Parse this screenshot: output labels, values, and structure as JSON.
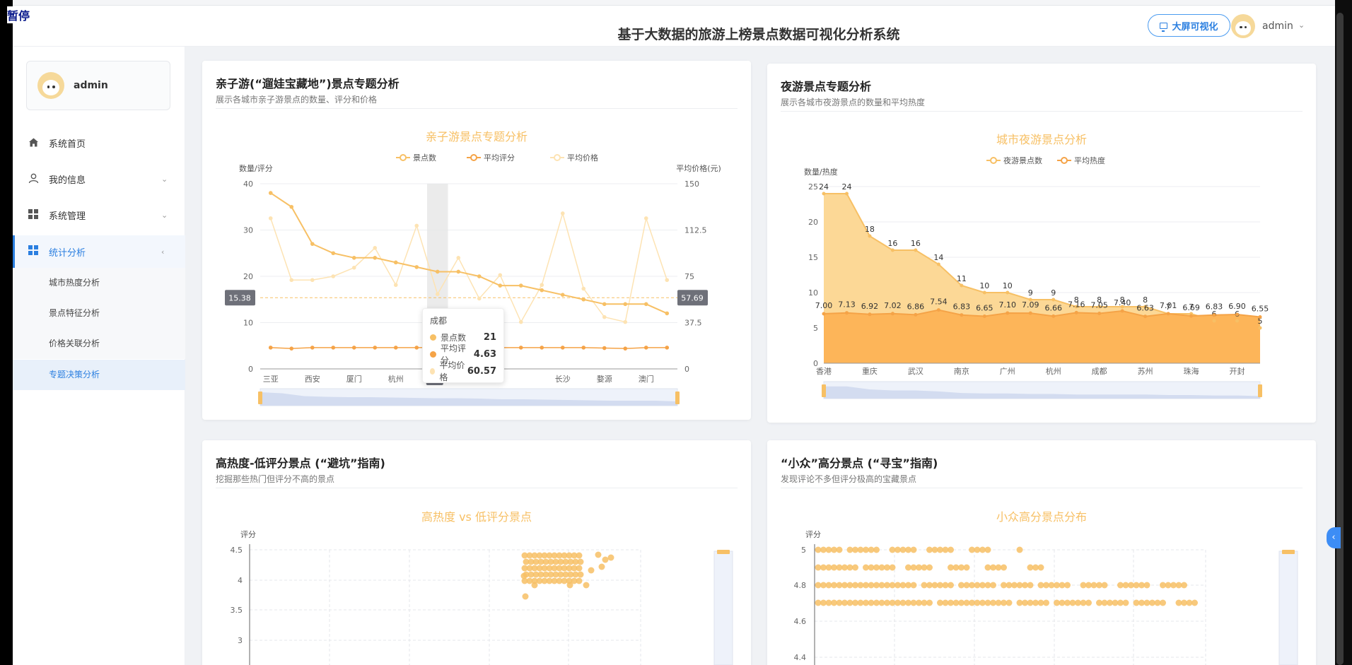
{
  "app": {
    "pause_label": "暂停",
    "title": "基于大数据的旅游上榜景点数据可视化分析系统",
    "bigscreen_label": "大屏可视化",
    "user_name": "admin"
  },
  "sidebar": {
    "user_name": "admin",
    "items": [
      {
        "label": "系统首页",
        "icon": "home-icon"
      },
      {
        "label": "我的信息",
        "icon": "user-icon"
      },
      {
        "label": "系统管理",
        "icon": "grid-icon"
      },
      {
        "label": "统计分析",
        "icon": "grid-icon"
      }
    ],
    "sub_items": [
      "城市热度分析",
      "景点特征分析",
      "价格关联分析",
      "专题决策分析"
    ]
  },
  "cards": {
    "family": {
      "title": "亲子游(“遛娃宝藏地”)景点专题分析",
      "subtitle": "展示各城市亲子游景点的数量、评分和价格"
    },
    "night": {
      "title": "夜游景点专题分析",
      "subtitle": "展示各城市夜游景点的数量和平均热度"
    },
    "avoid": {
      "title": "高热度-低评分景点 (“避坑”指南)",
      "subtitle": "挖掘那些热门但评分不高的景点"
    },
    "niche": {
      "title": "“小众”高分景点 (“寻宝”指南)",
      "subtitle": "发现评论不多但评分极高的宝藏景点"
    }
  },
  "tooltip": {
    "city": "成都",
    "rows": [
      {
        "label": "景点数",
        "value": "21",
        "color": "#f7c065"
      },
      {
        "label": "平均评分",
        "value": "4.63",
        "color": "#f5a347"
      },
      {
        "label": "平均价格",
        "value": "60.57",
        "color": "#fde3b3"
      }
    ]
  },
  "chart_data": [
    {
      "type": "line",
      "title": "亲子游景点专题分析",
      "legend": [
        "景点数",
        "平均评分",
        "平均价格"
      ],
      "ylabel": "数量/评分",
      "ylabel_right": "平均价格(元)",
      "ylim": [
        0,
        40
      ],
      "ylim_right": [
        0,
        150
      ],
      "tick_labels": [
        "三亚",
        "西安",
        "厦门",
        "杭州",
        "成",
        "长沙",
        "婺源",
        "澳门"
      ],
      "markline_left": "15.38",
      "markline_right": "57.69",
      "series": [
        {
          "name": "景点数",
          "values": [
            38,
            35,
            27,
            25,
            24,
            24,
            23,
            22,
            21,
            21,
            20,
            18,
            18,
            17,
            16,
            15,
            14,
            14,
            14,
            12
          ]
        },
        {
          "name": "平均评分",
          "values": [
            4.6,
            4.4,
            4.6,
            4.6,
            4.6,
            4.6,
            4.6,
            4.6,
            4.63,
            4.6,
            4.6,
            4.6,
            4.6,
            4.6,
            4.6,
            4.6,
            4.5,
            4.4,
            4.6,
            4.6
          ]
        },
        {
          "name": "平均价格",
          "values": [
            122,
            72,
            72,
            75,
            82,
            98,
            68,
            116,
            60.57,
            90,
            57,
            76,
            38,
            68,
            126,
            65,
            42,
            38,
            122,
            72
          ]
        }
      ],
      "tooltip_index": 8
    },
    {
      "type": "area",
      "title": "城市夜游景点分析",
      "legend": [
        "夜游景点数",
        "平均热度"
      ],
      "ylabel": "数量/热度",
      "ylim": [
        0,
        25
      ],
      "tick_labels": [
        "香港",
        "重庆",
        "武汉",
        "南京",
        "广州",
        "杭州",
        "成都",
        "苏州",
        "珠海",
        "开封"
      ],
      "series": [
        {
          "name": "夜游景点数",
          "values": [
            24,
            24,
            18,
            16,
            16,
            14,
            11,
            10,
            10,
            9,
            9,
            8,
            8,
            8,
            8,
            7,
            7,
            6,
            6,
            5
          ]
        },
        {
          "name": "平均热度",
          "values": [
            7.0,
            7.13,
            6.92,
            7.02,
            6.86,
            7.54,
            6.83,
            6.65,
            7.1,
            7.09,
            6.66,
            7.16,
            7.05,
            7.4,
            6.63,
            7.01,
            6.69,
            6.83,
            6.9,
            6.55
          ]
        }
      ]
    },
    {
      "type": "scatter",
      "title": "高热度 vs 低评分景点",
      "ylabel": "评分",
      "y_ticks": [
        "4.5",
        "4",
        "3.5",
        "3"
      ]
    },
    {
      "type": "scatter",
      "title": "小众高分景点分布",
      "ylabel": "评分",
      "y_ticks": [
        "5",
        "4.8",
        "4.6",
        "4.4"
      ]
    }
  ]
}
